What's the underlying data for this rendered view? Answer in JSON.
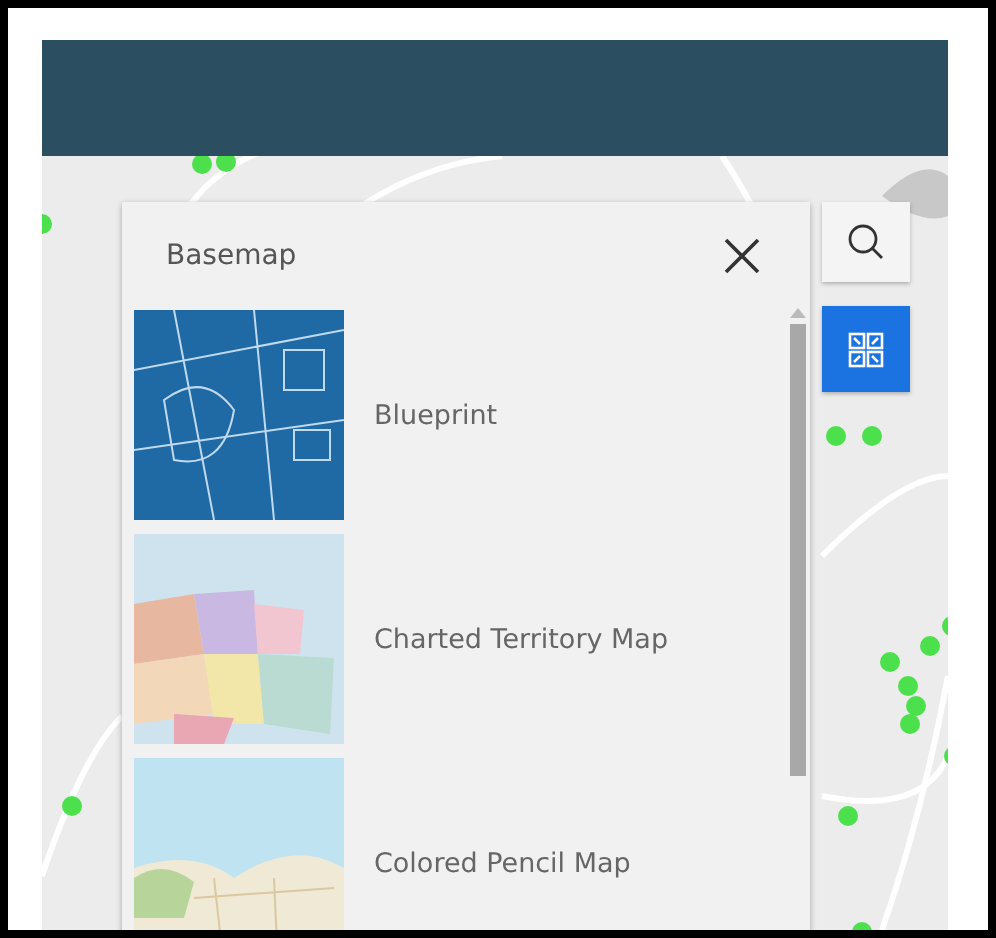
{
  "basemap_panel": {
    "title": "Basemap",
    "items": [
      {
        "label": "Blueprint"
      },
      {
        "label": "Charted Territory Map"
      },
      {
        "label": "Colored Pencil Map"
      }
    ]
  },
  "tools": [
    {
      "kind": "search",
      "selected": false
    },
    {
      "kind": "basemap-gallery",
      "selected": true
    }
  ]
}
